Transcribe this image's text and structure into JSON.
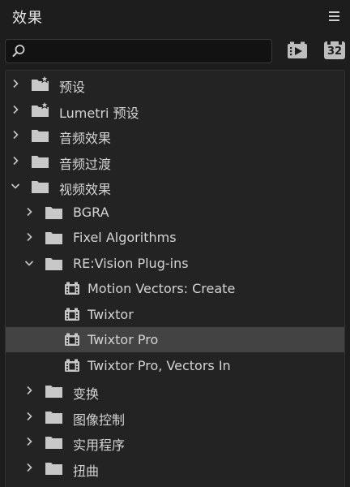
{
  "panel": {
    "title": "效果",
    "menu_icon": "hamburger-menu-icon"
  },
  "search": {
    "value": "",
    "placeholder": "",
    "icon": "search-icon"
  },
  "toolbar": {
    "accelerated_icon": "accelerated-effects-icon",
    "bit32_label": "32"
  },
  "tree": [
    {
      "label": "预设",
      "type": "preset-folder",
      "expanded": false,
      "level": 0
    },
    {
      "label": "Lumetri 预设",
      "type": "preset-folder",
      "expanded": false,
      "level": 0
    },
    {
      "label": "音频效果",
      "type": "folder",
      "expanded": false,
      "level": 0
    },
    {
      "label": "音频过渡",
      "type": "folder",
      "expanded": false,
      "level": 0
    },
    {
      "label": "视频效果",
      "type": "folder",
      "expanded": true,
      "level": 0
    },
    {
      "label": "BGRA",
      "type": "folder",
      "expanded": false,
      "level": 1
    },
    {
      "label": "Fixel Algorithms",
      "type": "folder",
      "expanded": false,
      "level": 1
    },
    {
      "label": "RE:Vision Plug-ins",
      "type": "folder",
      "expanded": true,
      "level": 1
    },
    {
      "label": "Motion Vectors: Create",
      "type": "effect",
      "level": 2
    },
    {
      "label": "Twixtor",
      "type": "effect",
      "level": 2
    },
    {
      "label": "Twixtor Pro",
      "type": "effect",
      "level": 2,
      "selected": true
    },
    {
      "label": "Twixtor Pro, Vectors In",
      "type": "effect",
      "level": 2
    },
    {
      "label": "变换",
      "type": "folder",
      "expanded": false,
      "level": 1
    },
    {
      "label": "图像控制",
      "type": "folder",
      "expanded": false,
      "level": 1
    },
    {
      "label": "实用程序",
      "type": "folder",
      "expanded": false,
      "level": 1
    },
    {
      "label": "扭曲",
      "type": "folder",
      "expanded": false,
      "level": 1
    }
  ],
  "colors": {
    "background": "#1d1d1d",
    "list_background": "#232323",
    "selected_row": "#434343",
    "icon": "#c8c8c8",
    "text": "#d4d4d4"
  }
}
